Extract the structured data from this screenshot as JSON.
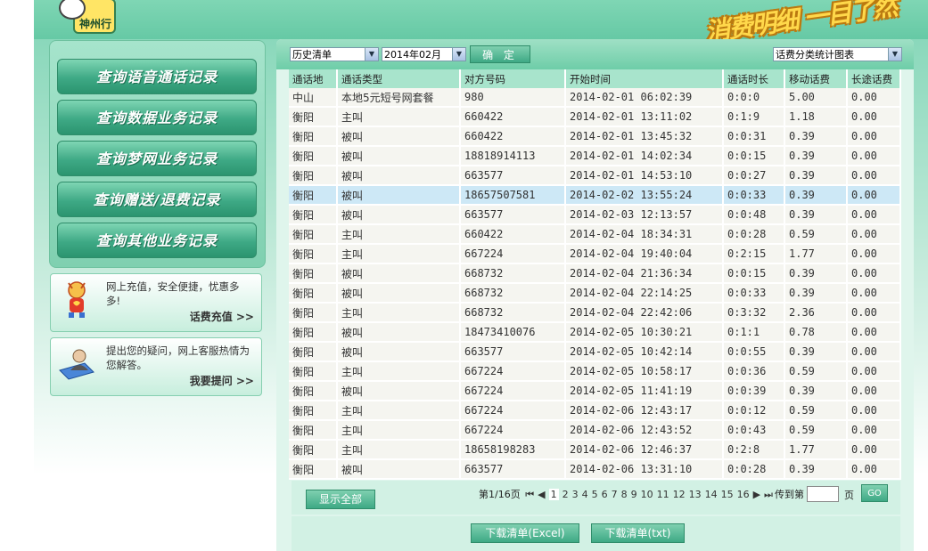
{
  "header": {
    "logo_text": "神州行",
    "slogan": "消费明细 一目了然"
  },
  "menu": {
    "items": [
      {
        "label": "查询语音通话记录"
      },
      {
        "label": "查询数据业务记录"
      },
      {
        "label": "查询梦网业务记录"
      },
      {
        "label": "查询赠送/退费记录"
      },
      {
        "label": "查询其他业务记录"
      }
    ]
  },
  "promos": [
    {
      "text": "网上充值，安全便捷，忧惠多多!",
      "link": "话费充值 >>"
    },
    {
      "text": "提出您的疑问，网上客服热情为您解答。",
      "link": "我要提问 >>"
    }
  ],
  "toolbar": {
    "list_type": "历史清单",
    "month": "2014年02月",
    "ok_label": "确 定",
    "chart_select": "话费分类统计图表"
  },
  "table": {
    "columns": [
      "通话地",
      "通话类型",
      "对方号码",
      "开始时间",
      "通话时长",
      "移动话费",
      "长途话费"
    ],
    "rows": [
      [
        "中山",
        "本地5元短号网套餐",
        "980",
        "2014-02-01 06:02:39",
        "0:0:0",
        "5.00",
        "0.00"
      ],
      [
        "衡阳",
        "主叫",
        "660422",
        "2014-02-01 13:11:02",
        "0:1:9",
        "1.18",
        "0.00"
      ],
      [
        "衡阳",
        "被叫",
        "660422",
        "2014-02-01 13:45:32",
        "0:0:31",
        "0.39",
        "0.00"
      ],
      [
        "衡阳",
        "被叫",
        "18818914113",
        "2014-02-01 14:02:34",
        "0:0:15",
        "0.39",
        "0.00"
      ],
      [
        "衡阳",
        "被叫",
        "663577",
        "2014-02-01 14:53:10",
        "0:0:27",
        "0.39",
        "0.00"
      ],
      [
        "衡阳",
        "被叫",
        "18657507581",
        "2014-02-02 13:55:24",
        "0:0:33",
        "0.39",
        "0.00"
      ],
      [
        "衡阳",
        "被叫",
        "663577",
        "2014-02-03 12:13:57",
        "0:0:48",
        "0.39",
        "0.00"
      ],
      [
        "衡阳",
        "主叫",
        "660422",
        "2014-02-04 18:34:31",
        "0:0:28",
        "0.59",
        "0.00"
      ],
      [
        "衡阳",
        "主叫",
        "667224",
        "2014-02-04 19:40:04",
        "0:2:15",
        "1.77",
        "0.00"
      ],
      [
        "衡阳",
        "被叫",
        "668732",
        "2014-02-04 21:36:34",
        "0:0:15",
        "0.39",
        "0.00"
      ],
      [
        "衡阳",
        "被叫",
        "668732",
        "2014-02-04 22:14:25",
        "0:0:33",
        "0.39",
        "0.00"
      ],
      [
        "衡阳",
        "主叫",
        "668732",
        "2014-02-04 22:42:06",
        "0:3:32",
        "2.36",
        "0.00"
      ],
      [
        "衡阳",
        "被叫",
        "18473410076",
        "2014-02-05 10:30:21",
        "0:1:1",
        "0.78",
        "0.00"
      ],
      [
        "衡阳",
        "被叫",
        "663577",
        "2014-02-05 10:42:14",
        "0:0:55",
        "0.39",
        "0.00"
      ],
      [
        "衡阳",
        "主叫",
        "667224",
        "2014-02-05 10:58:17",
        "0:0:36",
        "0.59",
        "0.00"
      ],
      [
        "衡阳",
        "被叫",
        "667224",
        "2014-02-05 11:41:19",
        "0:0:39",
        "0.39",
        "0.00"
      ],
      [
        "衡阳",
        "主叫",
        "667224",
        "2014-02-06 12:43:17",
        "0:0:12",
        "0.59",
        "0.00"
      ],
      [
        "衡阳",
        "主叫",
        "667224",
        "2014-02-06 12:43:52",
        "0:0:43",
        "0.59",
        "0.00"
      ],
      [
        "衡阳",
        "主叫",
        "18658198283",
        "2014-02-06 12:46:37",
        "0:2:8",
        "1.77",
        "0.00"
      ],
      [
        "衡阳",
        "被叫",
        "663577",
        "2014-02-06 13:31:10",
        "0:0:28",
        "0.39",
        "0.00"
      ]
    ],
    "selected_row": 5
  },
  "pagination": {
    "show_all": "显示全部",
    "page_info": "第1/16页",
    "first": "⏮",
    "prev": "◀",
    "pages": [
      "1",
      "2",
      "3",
      "4",
      "5",
      "6",
      "7",
      "8",
      "9",
      "10",
      "11",
      "12",
      "13",
      "14",
      "15",
      "16"
    ],
    "current": "1",
    "next": "▶",
    "last": "⏭",
    "goto_label": "传到第",
    "page_suffix": "页",
    "go_label": "GO"
  },
  "downloads": {
    "excel": "下载清单(Excel)",
    "txt": "下载清单(txt)"
  }
}
